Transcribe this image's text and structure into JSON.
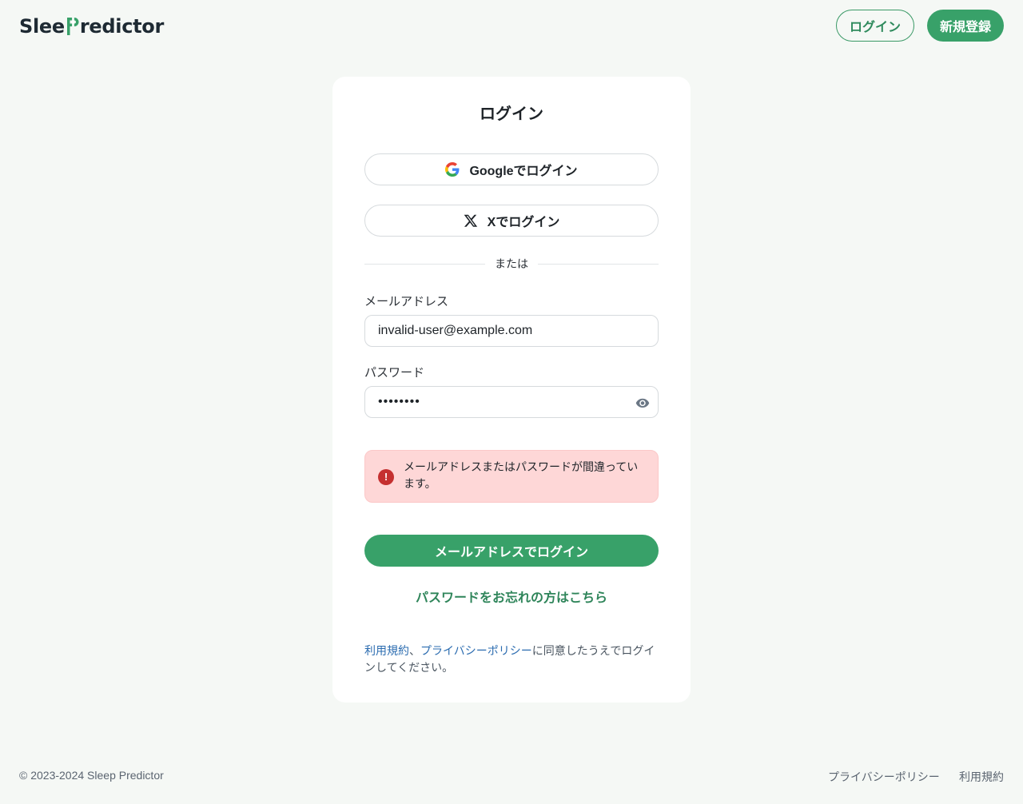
{
  "header": {
    "logo_prefix": "Slee",
    "logo_suffix": "redictor",
    "login_label": "ログイン",
    "signup_label": "新規登録"
  },
  "card": {
    "title": "ログイン",
    "google_label": "Googleでログイン",
    "x_label": "Xでログイン",
    "divider_text": "または",
    "email_label": "メールアドレス",
    "email_value": "invalid-user@example.com",
    "password_label": "パスワード",
    "password_value": "••••••••",
    "error_icon": "!",
    "error_message": "メールアドレスまたはパスワードが間違っています。",
    "submit_label": "メールアドレスでログイン",
    "forgot_label": "パスワードをお忘れの方はこちら",
    "terms_link": "利用規約",
    "terms_sep": "、",
    "privacy_link": "プライバシーポリシー",
    "terms_suffix": "に同意したうえでログインしてください。"
  },
  "footer": {
    "copyright": "© 2023-2024 Sleep Predictor",
    "privacy_label": "プライバシーポリシー",
    "terms_label": "利用規約"
  },
  "colors": {
    "brand_green": "#38a169",
    "error_bg": "#fed7d7",
    "error_icon": "#c53030",
    "link_blue": "#2b6cb0"
  },
  "icons": [
    "google-icon",
    "x-logo-icon",
    "eye-icon",
    "error-icon",
    "logo-p-mark-icon"
  ]
}
